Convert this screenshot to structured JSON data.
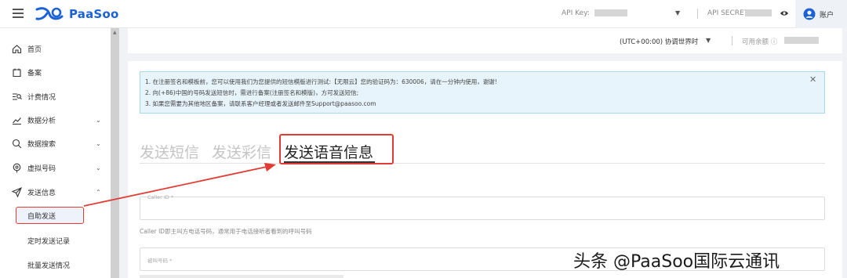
{
  "header": {
    "brand": "PaaSoo",
    "api_key_label": "API Key:",
    "api_secret_label": "API SECRET",
    "account_label": "账户"
  },
  "subheader": {
    "timezone": "(UTC+00:00) 协调世界时",
    "balance_label": "可用余额"
  },
  "sidebar": {
    "items": [
      {
        "label": "首页",
        "icon": "home-icon"
      },
      {
        "label": "备案",
        "icon": "filing-icon"
      },
      {
        "label": "计费情况",
        "icon": "billing-icon"
      },
      {
        "label": "数据分析",
        "icon": "chart-icon"
      },
      {
        "label": "数据搜索",
        "icon": "search-icon"
      },
      {
        "label": "虚拟号码",
        "icon": "location-icon"
      },
      {
        "label": "发送信息",
        "icon": "send-icon"
      }
    ],
    "sub_items": [
      {
        "label": "自助发送"
      },
      {
        "label": "定时发送记录"
      },
      {
        "label": "批量发送情况"
      }
    ]
  },
  "notice": {
    "lines": [
      "1. 在注册签名和模板前，您可以使用我们为您提供的短信模版进行测试:【无限云】您的验证码为：630006，请在一分钟内使用，谢谢!",
      "2. 向(+86)中国的号码发送短信时，需进行备案(注册签名和模版)，方可发送短信;",
      "3. 如果您需要为其他地区备案，请联系客户经理或者发送邮件至Support@paasoo.com"
    ]
  },
  "tabs": [
    {
      "label": "发送短信",
      "active": false
    },
    {
      "label": "发送彩信",
      "active": false
    },
    {
      "label": "发送语音信息",
      "active": true
    }
  ],
  "form": {
    "caller_id_label": "Caller ID *",
    "caller_id_hint": "Caller ID即主叫方电话号码，通常用于电话接听者看到的呼叫号码",
    "callee_label": "被叫号码 *"
  },
  "watermark": "头条 @PaaSoo国际云通讯",
  "colors": {
    "brand": "#1a62d6",
    "highlight": "#e23b34",
    "notice_bg": "#e7f4fb"
  }
}
